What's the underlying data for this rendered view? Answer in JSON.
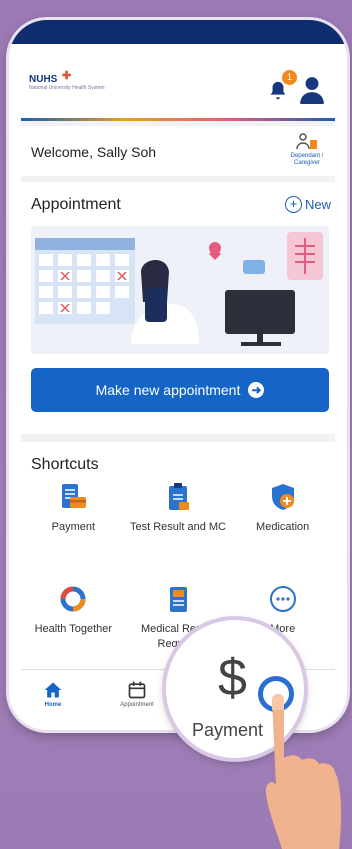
{
  "app": {
    "logo": "NUHS",
    "logo_sub": "National University Health System",
    "notification_count": "1"
  },
  "welcome": {
    "text": "Welcome, Sally Soh",
    "dependant_label": "Dependant / Caregiver"
  },
  "appointment": {
    "title": "Appointment",
    "new_label": "New",
    "cta_label": "Make new appointment"
  },
  "shortcuts": {
    "title": "Shortcuts",
    "items": [
      {
        "label": "Payment",
        "icon": "receipt-card-icon"
      },
      {
        "label": "Test Result and MC",
        "icon": "clipboard-icon"
      },
      {
        "label": "Medication",
        "icon": "pill-shield-icon"
      },
      {
        "label": "Health Together",
        "icon": "heart-ring-icon"
      },
      {
        "label": "Medical Report Request",
        "icon": "report-icon"
      },
      {
        "label": "More",
        "icon": "more-icon"
      }
    ]
  },
  "tabs": [
    {
      "label": "Home",
      "icon": "home-icon",
      "active": true
    },
    {
      "label": "Appointment",
      "icon": "calendar-icon",
      "active": false
    }
  ],
  "magnifier": {
    "symbol": "$",
    "label": "Payment"
  },
  "colors": {
    "primary": "#1565c7",
    "navy": "#0d2d6e",
    "badge": "#f08a1c",
    "bg": "#a37fb9"
  }
}
